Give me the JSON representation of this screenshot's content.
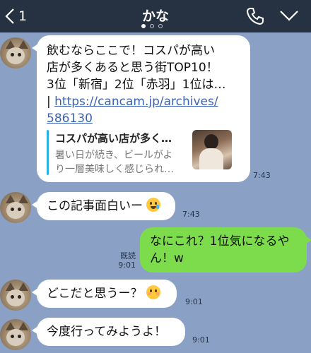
{
  "header": {
    "back_count": "1",
    "title": "かな",
    "page_dots": 3,
    "active_dot": 0
  },
  "messages": [
    {
      "side": "left",
      "text_lines": [
        "飲むならここで！コスパが高い",
        "店が多くあると思う街TOP10！",
        "3位「新宿」2位「赤羽」1位は…"
      ],
      "link_prefix": "| ",
      "link_line1": "https://cancam.jp/archives/",
      "link_line2": "586130",
      "preview": {
        "title": "コスパが高い店が多く…",
        "desc_line1": "暑い日が続き、ビールがよ",
        "desc_line2": "り一層美味しく感じられ…"
      },
      "time": "7:43"
    },
    {
      "side": "left",
      "text": "この記事面白いー",
      "emoji": "rolling-on-floor-laughing",
      "time": "7:43"
    },
    {
      "side": "right",
      "line1": "なにこれ？1位気になるや",
      "line2": "ん！w",
      "read_label": "既読",
      "time": "9:01"
    },
    {
      "side": "left",
      "text": "どこだと思うー？",
      "emoji": "kissing-face",
      "time": "9:01"
    },
    {
      "side": "left",
      "text": "今度行ってみようよ！",
      "time": "9:01"
    }
  ],
  "colors": {
    "header_bg": "#263142",
    "chat_bg": "#8aa1c5",
    "bubble_sent": "#7ddc4c",
    "bubble_received": "#ffffff",
    "link": "#3b62b5"
  }
}
